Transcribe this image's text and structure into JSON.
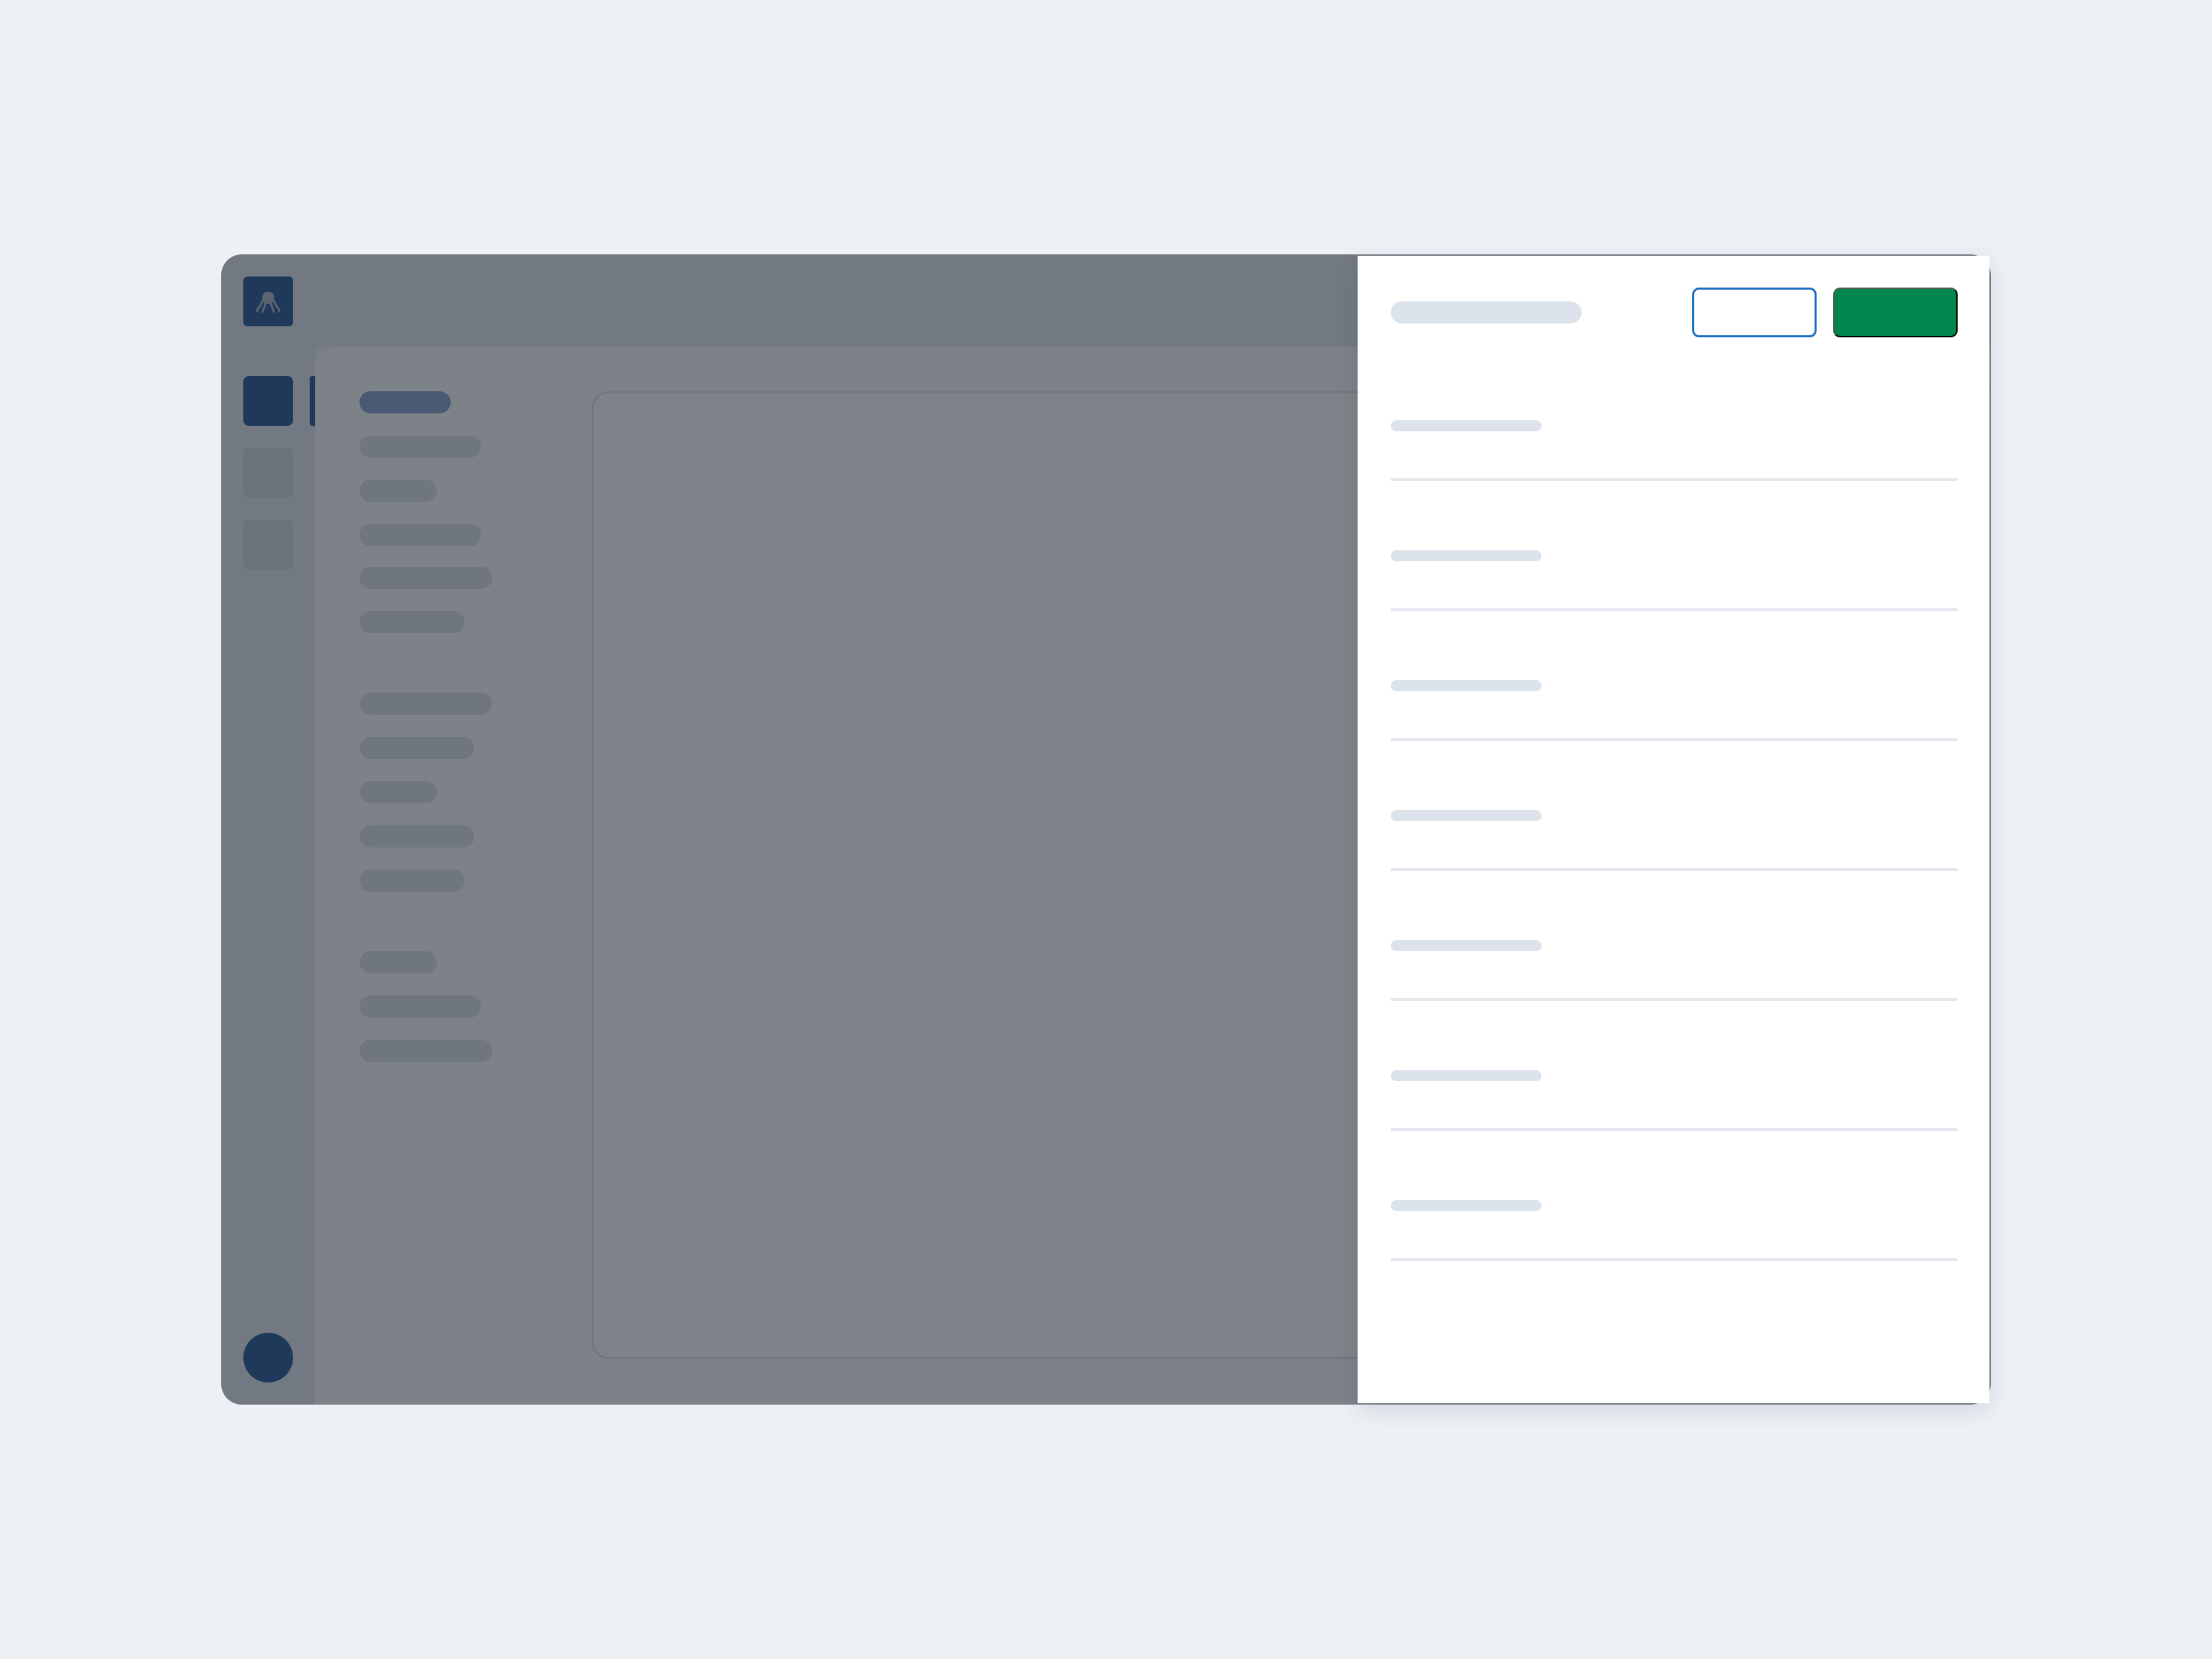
{
  "app": {
    "logo_icon": "octopus-logo-icon",
    "accent_color": "#1a4f8f",
    "rail": {
      "items": [
        {
          "name": "rail-item-1",
          "active": true
        },
        {
          "name": "rail-item-2",
          "active": false
        },
        {
          "name": "rail-item-3",
          "active": false
        }
      ],
      "avatar_icon": "user-avatar-icon"
    },
    "navigation": {
      "groups": [
        {
          "items": [
            "",
            "",
            "",
            "",
            "",
            ""
          ],
          "selected_index": 0
        },
        {
          "items": [
            "",
            "",
            "",
            "",
            ""
          ]
        },
        {
          "items": [
            "",
            "",
            ""
          ]
        }
      ]
    },
    "overlay_color": "#222a34"
  },
  "side_panel": {
    "title": "",
    "cancel_button": {
      "label": ""
    },
    "save_button": {
      "label": "",
      "color": "#00874d"
    },
    "fields": [
      {
        "label": "",
        "value": ""
      },
      {
        "label": "",
        "value": ""
      },
      {
        "label": "",
        "value": ""
      },
      {
        "label": "",
        "value": ""
      },
      {
        "label": "",
        "value": ""
      },
      {
        "label": "",
        "value": ""
      },
      {
        "label": "",
        "value": ""
      }
    ]
  }
}
